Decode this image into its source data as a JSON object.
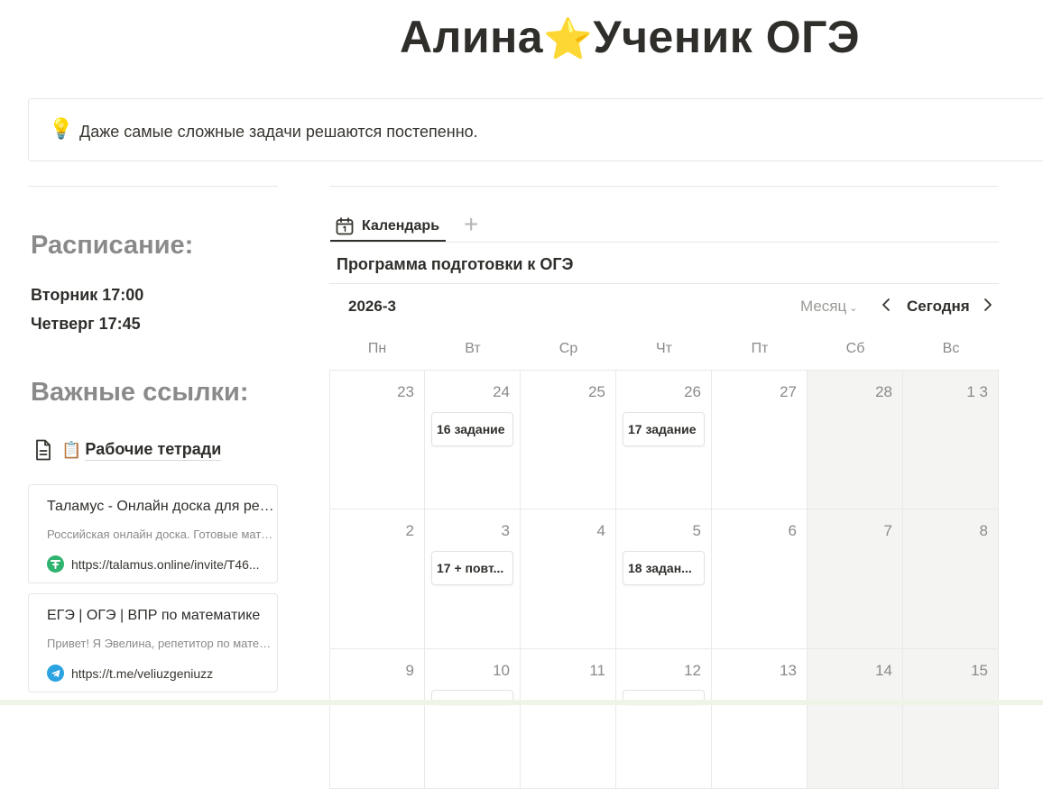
{
  "page": {
    "title_prefix": "Алина",
    "title_star": "⭐",
    "title_suffix": "Ученик ОГЭ"
  },
  "callout": {
    "icon": "lightbulb-icon",
    "icon_glyph": "💡",
    "text": "Даже самые сложные задачи решаются постепенно."
  },
  "schedule": {
    "heading": "Расписание:",
    "lines": [
      "Вторник 17:00",
      "Четверг 17:45"
    ]
  },
  "links": {
    "heading": "Важные ссылки:",
    "page_link": {
      "icon": "document-icon",
      "emoji": "📋",
      "label": "Рабочие тетради"
    },
    "bookmarks": [
      {
        "title": "Таламус - Онлайн доска для репетиторов",
        "description": "Российская онлайн доска. Готовые материалы для занятий",
        "url": "https://talamus.online/invite/T46...",
        "favicon": "talamus-icon",
        "favicon_color": "#2fb36f"
      },
      {
        "title": "ЕГЭ | ОГЭ | ВПР по математике",
        "description": "Привет! Я Эвелина, репетитор по математике",
        "url": "https://t.me/veliuzgeniuzz",
        "favicon": "telegram-icon",
        "favicon_color": "#2aa3e0"
      }
    ]
  },
  "database": {
    "view_tab": {
      "icon": "calendar-icon",
      "label": "Календарь"
    },
    "add_view_icon": "plus-icon",
    "title": "Программа подготовки к ОГЭ"
  },
  "calendar": {
    "month": "2026-3",
    "view_mode": "Месяц",
    "today_label": "Сегодня",
    "prev_icon": "chevron-left-icon",
    "next_icon": "chevron-right-icon",
    "weekdays": [
      "Пн",
      "Вт",
      "Ср",
      "Чт",
      "Пт",
      "Сб",
      "Вс"
    ],
    "weeks": [
      [
        {
          "day": "23",
          "events": []
        },
        {
          "day": "24",
          "events": [
            "16 задание"
          ]
        },
        {
          "day": "25",
          "events": []
        },
        {
          "day": "26",
          "events": [
            "17 задание"
          ]
        },
        {
          "day": "27",
          "events": []
        },
        {
          "day": "28",
          "events": []
        },
        {
          "day": "1 3",
          "events": []
        }
      ],
      [
        {
          "day": "2",
          "events": []
        },
        {
          "day": "3",
          "events": [
            "17 + повт..."
          ]
        },
        {
          "day": "4",
          "events": []
        },
        {
          "day": "5",
          "events": [
            "18 задан..."
          ]
        },
        {
          "day": "6",
          "events": []
        },
        {
          "day": "7",
          "events": []
        },
        {
          "day": "8",
          "events": []
        }
      ],
      [
        {
          "day": "9",
          "events": []
        },
        {
          "day": "10",
          "events": [
            ""
          ]
        },
        {
          "day": "11",
          "events": []
        },
        {
          "day": "12",
          "events": [
            ""
          ]
        },
        {
          "day": "13",
          "events": []
        },
        {
          "day": "14",
          "events": []
        },
        {
          "day": "15",
          "events": []
        }
      ]
    ],
    "weekend_color": "#f4f4f3"
  }
}
